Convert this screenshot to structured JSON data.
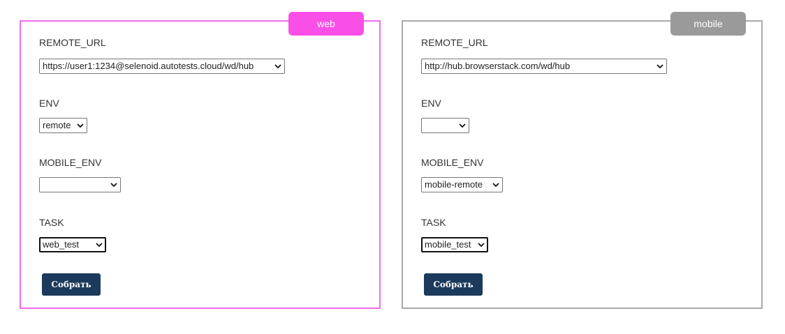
{
  "web": {
    "tag": "web",
    "fields": {
      "remote_url": {
        "label": "REMOTE_URL",
        "value": "https://user1:1234@selenoid.autotests.cloud/wd/hub"
      },
      "env": {
        "label": "ENV",
        "value": "remote"
      },
      "mobile_env": {
        "label": "MOBILE_ENV",
        "value": ""
      },
      "task": {
        "label": "TASK",
        "value": "web_test"
      }
    },
    "submit_label": "Собрать"
  },
  "mobile": {
    "tag": "mobile",
    "fields": {
      "remote_url": {
        "label": "REMOTE_URL",
        "value": "http://hub.browserstack.com/wd/hub"
      },
      "env": {
        "label": "ENV",
        "value": ""
      },
      "mobile_env": {
        "label": "MOBILE_ENV",
        "value": "mobile-remote"
      },
      "task": {
        "label": "TASK",
        "value": "mobile_test"
      }
    },
    "submit_label": "Собрать"
  },
  "colors": {
    "web_accent": "#f94fe6",
    "web_border": "#f26bf0",
    "mobile_accent": "#9a9a9a",
    "mobile_border": "#a9a9a9",
    "button": "#1b3a5c"
  },
  "icons": {
    "select_arrow": "chevron-down-icon"
  }
}
